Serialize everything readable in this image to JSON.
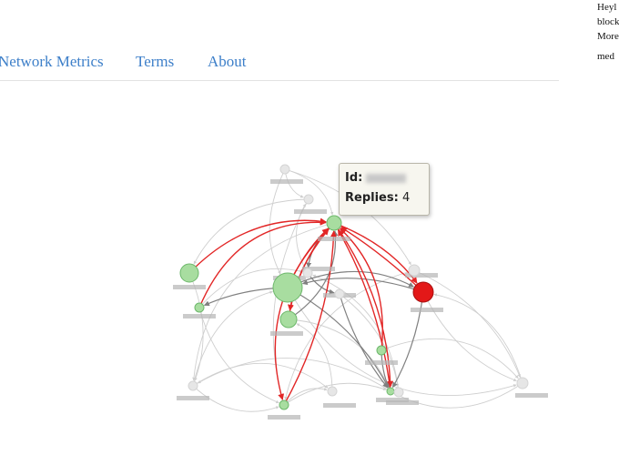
{
  "nav": {
    "items": [
      {
        "label": "Network Metrics"
      },
      {
        "label": "Terms"
      },
      {
        "label": "About"
      }
    ]
  },
  "side_text": {
    "line1": "Heyl",
    "line2": "block",
    "line3": "More",
    "line4": "med"
  },
  "tooltip": {
    "id_label": "Id:",
    "replies_label": "Replies:",
    "replies_value": "4"
  },
  "graph": {
    "colors": {
      "node_default": "#a8dda0",
      "node_border": "#6db86b",
      "node_faded": "#e6e6e6",
      "node_selected": "#e31818",
      "edge_highlight": "#e22626",
      "edge_dark": "#808080",
      "edge_light": "#cfcfcf"
    },
    "nodes": [
      {
        "id": "n1",
        "r": 10,
        "kind": "default"
      },
      {
        "id": "n2",
        "r": 16,
        "kind": "default"
      },
      {
        "id": "n3",
        "r": 9,
        "kind": "default"
      },
      {
        "id": "n4",
        "r": 8,
        "kind": "default"
      },
      {
        "id": "n5",
        "r": 5,
        "kind": "default"
      },
      {
        "id": "n6",
        "r": 11,
        "kind": "selected"
      },
      {
        "id": "n7",
        "r": 5,
        "kind": "default"
      },
      {
        "id": "n8",
        "r": 5,
        "kind": "default"
      },
      {
        "id": "n9",
        "r": 4,
        "kind": "default"
      },
      {
        "id": "n10",
        "r": 5,
        "kind": "faded"
      },
      {
        "id": "n11",
        "r": 5,
        "kind": "faded"
      },
      {
        "id": "n12",
        "r": 6,
        "kind": "faded"
      },
      {
        "id": "n13",
        "r": 5,
        "kind": "faded"
      },
      {
        "id": "n14",
        "r": 5,
        "kind": "faded"
      },
      {
        "id": "n15",
        "r": 5,
        "kind": "faded"
      },
      {
        "id": "n16",
        "r": 6,
        "kind": "faded"
      },
      {
        "id": "n17",
        "r": 5,
        "kind": "faded"
      },
      {
        "id": "n18",
        "r": 5,
        "kind": "faded"
      }
    ]
  }
}
